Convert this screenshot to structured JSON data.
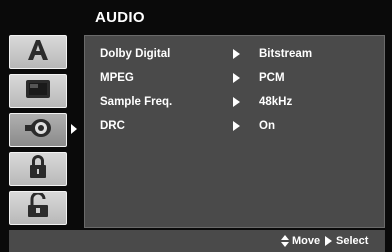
{
  "menu": {
    "title": "AUDIO"
  },
  "sidebar": {
    "tabs": [
      {
        "icon": "language-a-icon"
      },
      {
        "icon": "display-icon"
      },
      {
        "icon": "speaker-audio-icon"
      },
      {
        "icon": "lock-icon"
      },
      {
        "icon": "other-settings-icon"
      }
    ],
    "active_index": 2
  },
  "settings": [
    {
      "label": "Dolby Digital",
      "value": "Bitstream"
    },
    {
      "label": "MPEG",
      "value": "PCM"
    },
    {
      "label": "Sample Freq.",
      "value": "48kHz"
    },
    {
      "label": "DRC",
      "value": "On"
    }
  ],
  "footer": {
    "move_label": "Move",
    "select_label": "Select"
  },
  "colors": {
    "background": "#0a0a0a",
    "panel": "#4a4a4a",
    "tab": "#c8c8c8",
    "text": "#ffffff"
  }
}
